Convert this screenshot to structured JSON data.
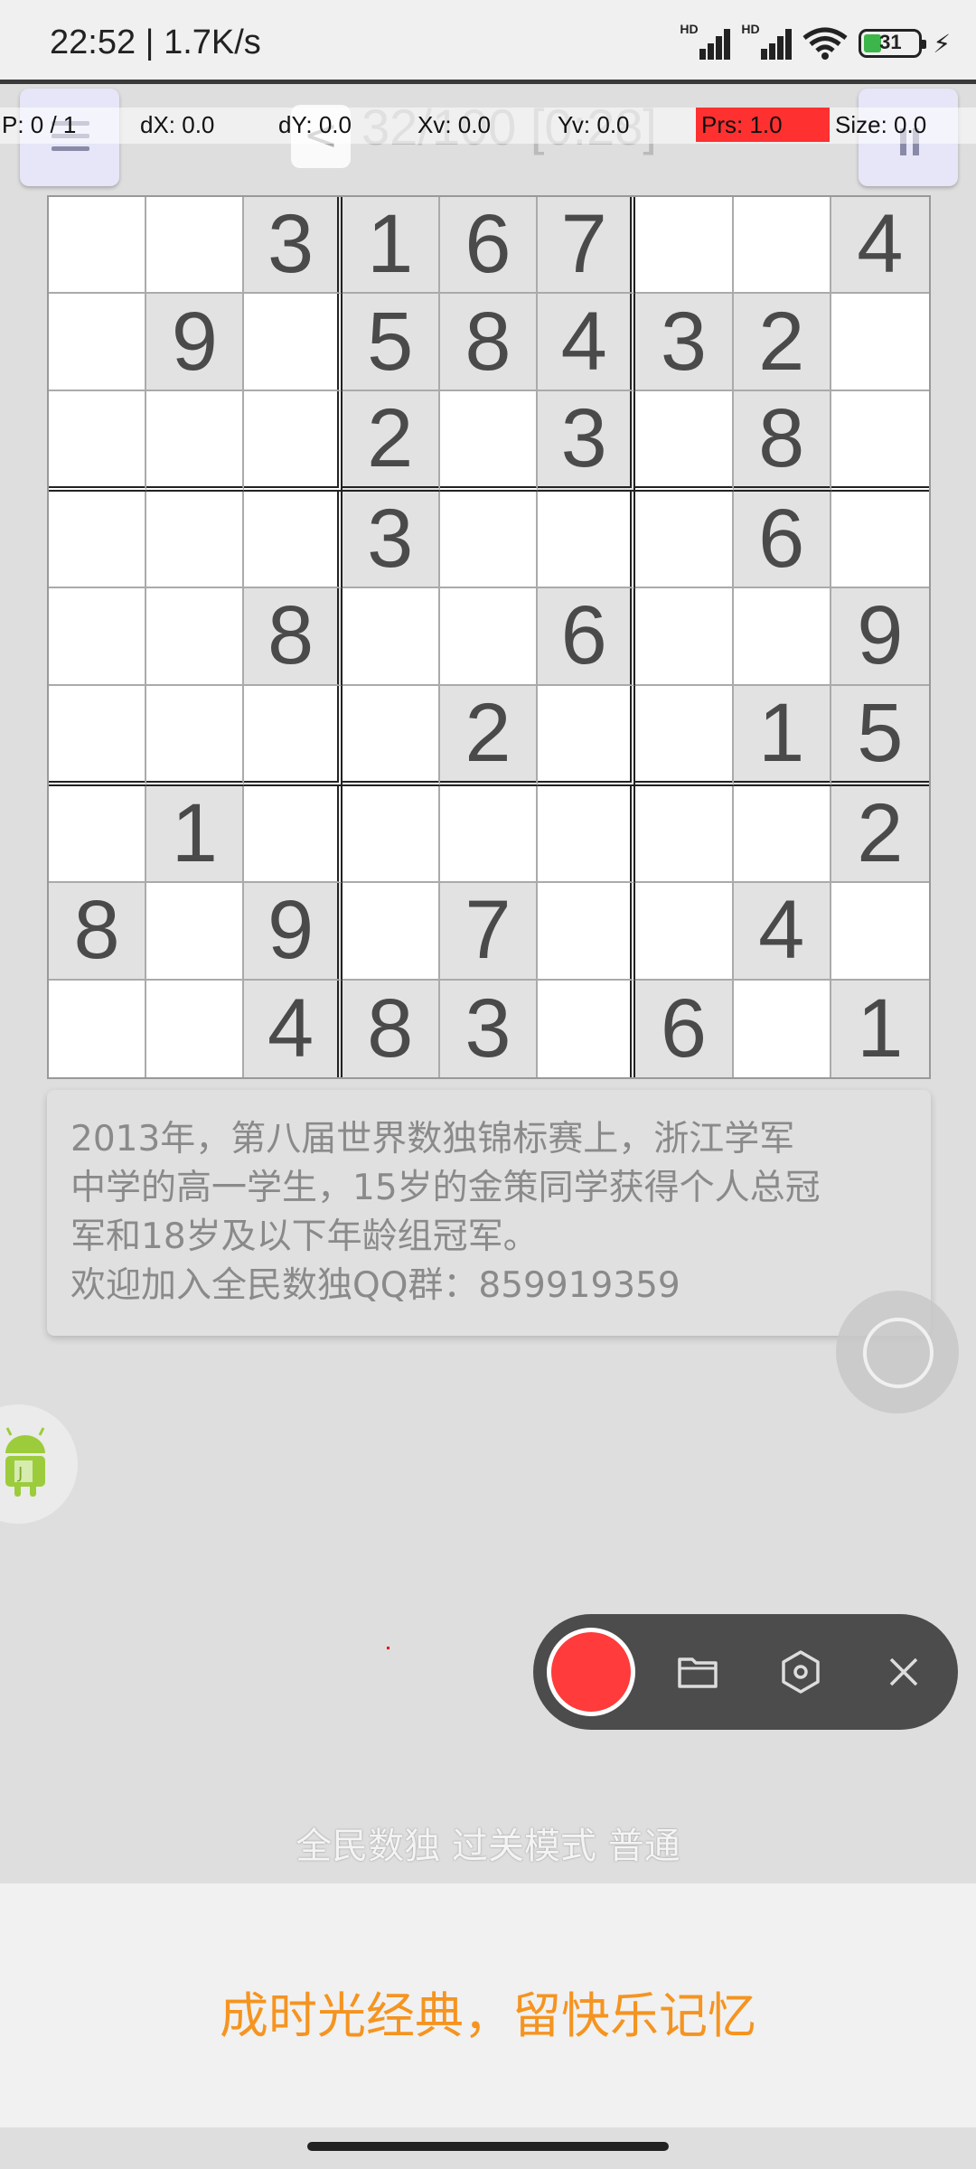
{
  "status_bar": {
    "time": "22:52 | 1.7K/s",
    "signal1_label": "HD",
    "signal2_label": "HD",
    "battery": "31"
  },
  "header": {
    "title": "32/100 [0:28]",
    "back_glyph": "<"
  },
  "pointer_overlay": {
    "p": "P: 0 / 1",
    "dx": "dX: 0.0",
    "dy": "dY: 0.0",
    "xv": "Xv: 0.0",
    "yv": "Yv: 0.0",
    "prs": "Prs: 1.0",
    "size": "Size: 0.0"
  },
  "board": {
    "rows": [
      [
        "",
        "",
        "3",
        "1",
        "6",
        "7",
        "",
        "",
        "4"
      ],
      [
        "",
        "9",
        "",
        "5",
        "8",
        "4",
        "3",
        "2",
        ""
      ],
      [
        "",
        "",
        "",
        "2",
        "",
        "3",
        "",
        "8",
        ""
      ],
      [
        "",
        "",
        "",
        "3",
        "",
        "",
        "",
        "6",
        ""
      ],
      [
        "",
        "",
        "8",
        "",
        "",
        "6",
        "",
        "",
        "9"
      ],
      [
        "",
        "",
        "",
        "",
        "2",
        "",
        "",
        "1",
        "5"
      ],
      [
        "",
        "1",
        "",
        "",
        "",
        "",
        "",
        "",
        "2"
      ],
      [
        "8",
        "",
        "9",
        "",
        "7",
        "",
        "",
        "4",
        ""
      ],
      [
        "",
        "",
        "4",
        "8",
        "3",
        "",
        "6",
        "",
        "1"
      ]
    ]
  },
  "tip": {
    "lines": [
      "2013年，第八届世界数独锦标赛上，浙江学军",
      "中学的高一学生，15岁的金策同学获得个人总冠",
      "军和18岁及以下年龄组冠军。",
      "欢迎加入全民数独QQ群：859919359"
    ]
  },
  "footer": {
    "mode_label": "全民数独 过关模式 普通",
    "ad_text": "成时光经典，留快乐记忆"
  },
  "icons": {
    "recorder": [
      "record-icon",
      "folder-icon",
      "settings-hex-icon",
      "close-icon"
    ]
  },
  "colors": {
    "record": "#ff3b3b",
    "prs_highlight": "#ff3030",
    "ad_text": "#f59420"
  }
}
